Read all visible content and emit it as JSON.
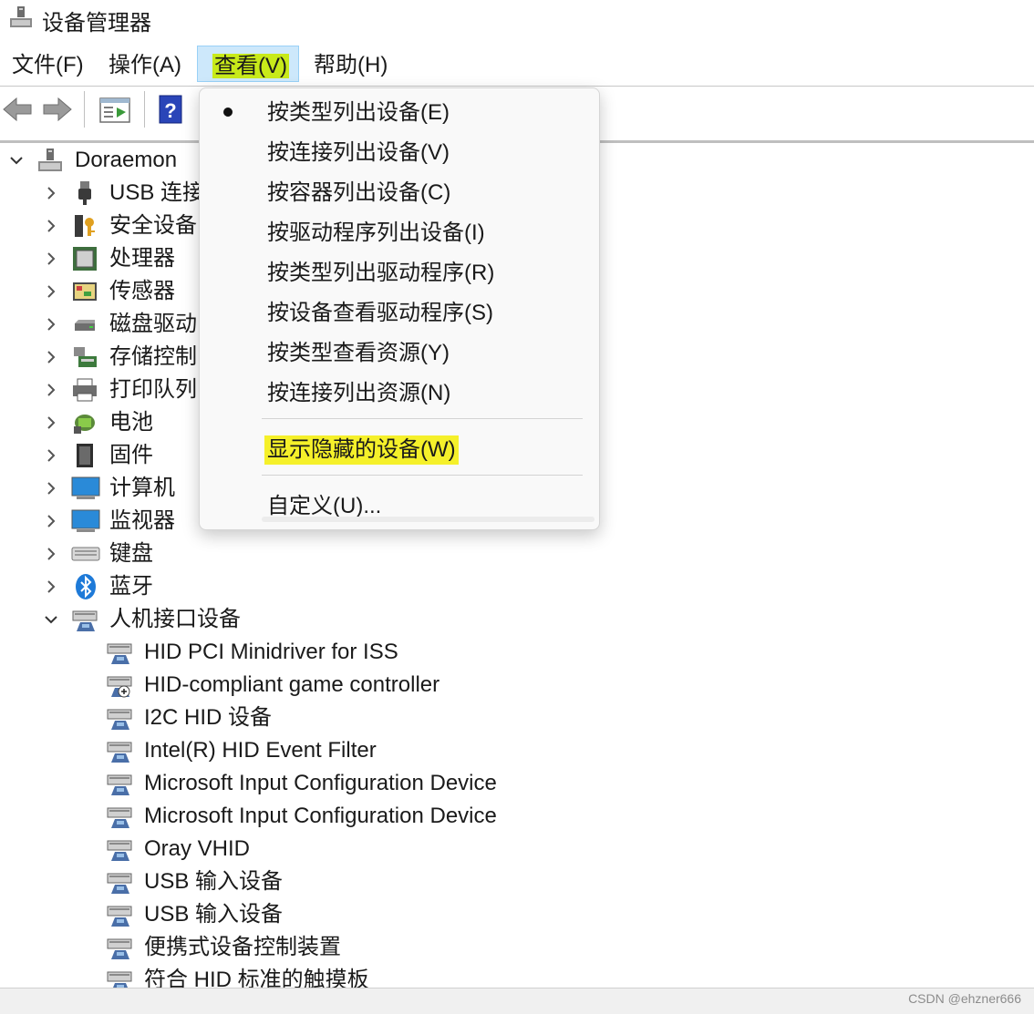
{
  "window": {
    "title": "设备管理器",
    "app_icon": "device-manager-icon"
  },
  "menubar": {
    "items": [
      {
        "label": "文件(F)",
        "active": false
      },
      {
        "label": "操作(A)",
        "active": false
      },
      {
        "label": "查看(V)",
        "active": true
      },
      {
        "label": "帮助(H)",
        "active": false
      }
    ]
  },
  "toolbar": {
    "buttons": [
      "back-arrow-icon",
      "forward-arrow-icon",
      "properties-panel-icon",
      "help-icon"
    ]
  },
  "tree": {
    "root": {
      "label": "Doraemon",
      "expanded": true,
      "icon": "computer-tower-icon"
    },
    "categories": [
      {
        "label": "USB 连接",
        "icon": "usb-plug-icon",
        "expanded": false
      },
      {
        "label": "安全设备",
        "icon": "security-key-icon",
        "expanded": false
      },
      {
        "label": "处理器",
        "icon": "processor-chip-icon",
        "expanded": false
      },
      {
        "label": "传感器",
        "icon": "sensor-icon",
        "expanded": false
      },
      {
        "label": "磁盘驱动",
        "icon": "disk-drive-icon",
        "expanded": false
      },
      {
        "label": "存储控制",
        "icon": "storage-controller-icon",
        "expanded": false
      },
      {
        "label": "打印队列",
        "icon": "printer-icon",
        "expanded": false
      },
      {
        "label": "电池",
        "icon": "battery-icon",
        "expanded": false
      },
      {
        "label": "固件",
        "icon": "firmware-icon",
        "expanded": false
      },
      {
        "label": "计算机",
        "icon": "computer-monitor-icon",
        "expanded": false
      },
      {
        "label": "监视器",
        "icon": "monitor-icon",
        "expanded": false
      },
      {
        "label": "键盘",
        "icon": "keyboard-icon",
        "expanded": false
      },
      {
        "label": "蓝牙",
        "icon": "bluetooth-icon",
        "expanded": false
      },
      {
        "label": "人机接口设备",
        "icon": "hid-icon",
        "expanded": true
      }
    ],
    "hid_children": [
      "HID PCI Minidriver for ISS",
      "HID-compliant game controller",
      "I2C HID 设备",
      "Intel(R) HID Event Filter",
      "Microsoft Input Configuration Device",
      "Microsoft Input Configuration Device",
      "Oray VHID",
      "USB 输入设备",
      "USB 输入设备",
      "便携式设备控制装置",
      "符合 HID 标准的触摸板"
    ]
  },
  "view_menu": {
    "items": [
      {
        "label": "按类型列出设备(E)",
        "checked": true
      },
      {
        "label": "按连接列出设备(V)",
        "checked": false
      },
      {
        "label": "按容器列出设备(C)",
        "checked": false
      },
      {
        "label": "按驱动程序列出设备(I)",
        "checked": false
      },
      {
        "label": "按类型列出驱动程序(R)",
        "checked": false
      },
      {
        "label": "按设备查看驱动程序(S)",
        "checked": false
      },
      {
        "label": "按类型查看资源(Y)",
        "checked": false
      },
      {
        "label": "按连接列出资源(N)",
        "checked": false
      }
    ],
    "show_hidden": "显示隐藏的设备(W)",
    "customize": "自定义(U)..."
  },
  "watermark": "CSDN @ehzner666",
  "colors": {
    "menu_active_bg": "#cde8fb",
    "highlight_yellow": "#f5f02a"
  }
}
